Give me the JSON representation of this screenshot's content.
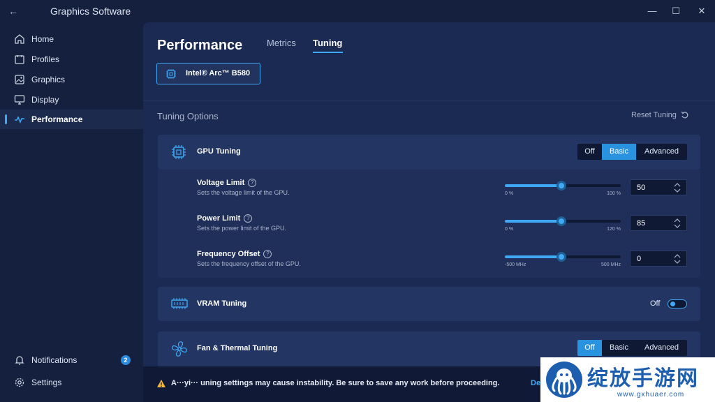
{
  "window": {
    "title": "Graphics Software",
    "controls": {
      "minimize": "—",
      "maximize": "☐",
      "close": "✕"
    }
  },
  "sidebar": {
    "items": [
      {
        "label": "Home",
        "icon": "home-icon"
      },
      {
        "label": "Profiles",
        "icon": "profiles-icon"
      },
      {
        "label": "Graphics",
        "icon": "graphics-icon"
      },
      {
        "label": "Display",
        "icon": "display-icon"
      },
      {
        "label": "Performance",
        "icon": "performance-icon",
        "active": true
      }
    ],
    "bottom": [
      {
        "label": "Notifications",
        "icon": "bell-icon",
        "badge": "2"
      },
      {
        "label": "Settings",
        "icon": "gear-icon"
      }
    ]
  },
  "header": {
    "title": "Performance",
    "tabs": [
      {
        "label": "Metrics"
      },
      {
        "label": "Tuning",
        "active": true
      }
    ],
    "gpu_selector": "Intel® Arc™ B580"
  },
  "tuning": {
    "section_label": "Tuning Options",
    "reset_label": "Reset Tuning",
    "gpu_tuning": {
      "title": "GPU Tuning",
      "mode_options": [
        "Off",
        "Basic",
        "Advanced"
      ],
      "selected_mode": "Basic",
      "params": [
        {
          "title": "Voltage Limit",
          "desc": "Sets the voltage limit of the GPU.",
          "min_label": "0 %",
          "max_label": "100 %",
          "value": "50",
          "level": 0.5
        },
        {
          "title": "Power Limit",
          "desc": "Sets the power limit of the GPU.",
          "min_label": "0 %",
          "max_label": "120 %",
          "value": "85",
          "level": 0.5
        },
        {
          "title": "Frequency Offset",
          "desc": "Sets the frequency offset of the GPU.",
          "min_label": "-500 MHz",
          "max_label": "500 MHz",
          "value": "0",
          "level": 0.5
        }
      ]
    },
    "vram_tuning": {
      "title": "VRAM Tuning",
      "toggle_label": "Off"
    },
    "fan_tuning": {
      "title": "Fan & Thermal Tuning",
      "mode_options": [
        "Off",
        "Basic",
        "Advanced"
      ],
      "selected_mode": "Off"
    }
  },
  "warning": {
    "text": "A···yi··· uning settings may cause instability. Be sure to save any work before proceeding.",
    "link": "De"
  },
  "watermark": {
    "text": "绽放手游网",
    "url": "www.gxhuaer.com"
  },
  "colors": {
    "accent": "#3fa9f5",
    "background": "#14203d",
    "panel": "#1b2a52",
    "card": "#233563"
  }
}
